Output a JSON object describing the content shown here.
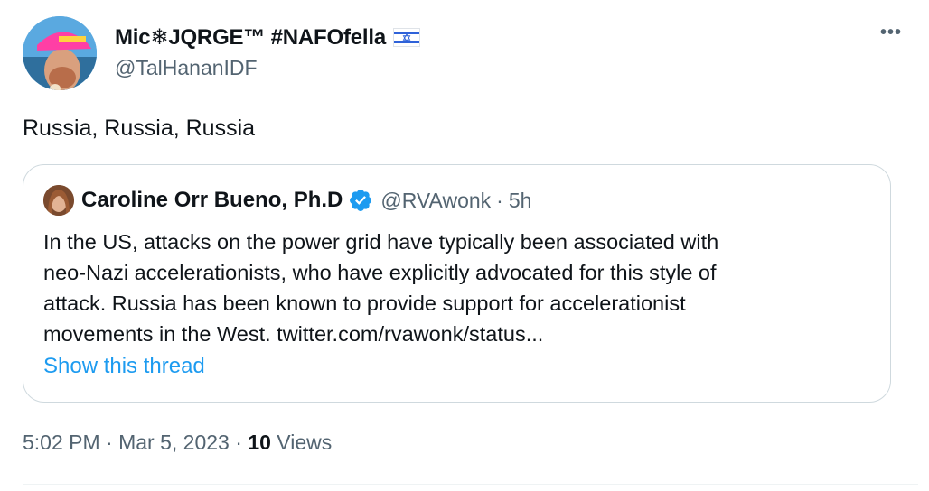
{
  "author": {
    "display_name": "Mic❄JQRGE™ #NAFOfella",
    "handle": "@TalHananIDF",
    "flag_icon": "israel-flag-icon"
  },
  "more_label": "•••",
  "tweet": {
    "text": "Russia, Russia, Russia"
  },
  "quoted": {
    "name": "Caroline Orr Bueno, Ph.D",
    "handle": "@RVAwonk",
    "separator": "·",
    "time": "5h",
    "verified_icon": "verified-badge-icon",
    "body_lines": [
      "In the US, attacks on the power grid have typically been associated with",
      "neo-Nazi accelerationists, who have explicitly advocated for this style of",
      "attack. Russia has been known to provide support for accelerationist",
      "movements in the West. twitter.com/rvawonk/status..."
    ],
    "show_thread": "Show this thread"
  },
  "meta": {
    "time": "5:02 PM",
    "sep1": "·",
    "date": "Mar 5, 2023",
    "sep2": "·",
    "views_count": "10",
    "views_label": "Views"
  },
  "colors": {
    "text": "#0f1419",
    "secondary": "#536471",
    "link": "#1d9bf0",
    "border": "#cfd9de",
    "verified": "#1d9bf0"
  }
}
